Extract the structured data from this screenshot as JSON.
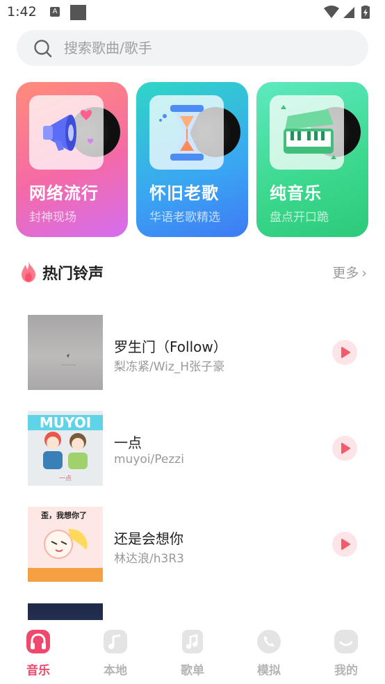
{
  "status_bar": {
    "time": "1:42",
    "a_badge": "A"
  },
  "search": {
    "placeholder": "搜索歌曲/歌手"
  },
  "categories": [
    {
      "title": "网络流行",
      "subtitle": "封神现场",
      "icon": "megaphone-icon"
    },
    {
      "title": "怀旧老歌",
      "subtitle": "华语老歌精选",
      "icon": "hourglass-icon"
    },
    {
      "title": "纯音乐",
      "subtitle": "盘点开口跪",
      "icon": "piano-icon"
    }
  ],
  "section": {
    "title": "热门铃声",
    "more": "更多"
  },
  "songs": [
    {
      "title": "罗生门（Follow）",
      "artist": "梨冻紧/Wiz_H张子豪"
    },
    {
      "title": "一点",
      "artist": "muyoi/Pezzi"
    },
    {
      "title": "还是会想你",
      "artist": "林达浪/h3R3",
      "cover_text": "歪，我想你了"
    }
  ],
  "cover_texts": {
    "song2_banner": "MUYOI",
    "song2_caption": "一点"
  },
  "nav": [
    {
      "label": "音乐",
      "active": true
    },
    {
      "label": "本地",
      "active": false
    },
    {
      "label": "歌单",
      "active": false
    },
    {
      "label": "模拟",
      "active": false
    },
    {
      "label": "我的",
      "active": false
    }
  ],
  "colors": {
    "accent": "#f0476c",
    "play_bg": "#fde4e6",
    "play_fg": "#f25b6a",
    "search_bg": "#f2f3f5"
  }
}
